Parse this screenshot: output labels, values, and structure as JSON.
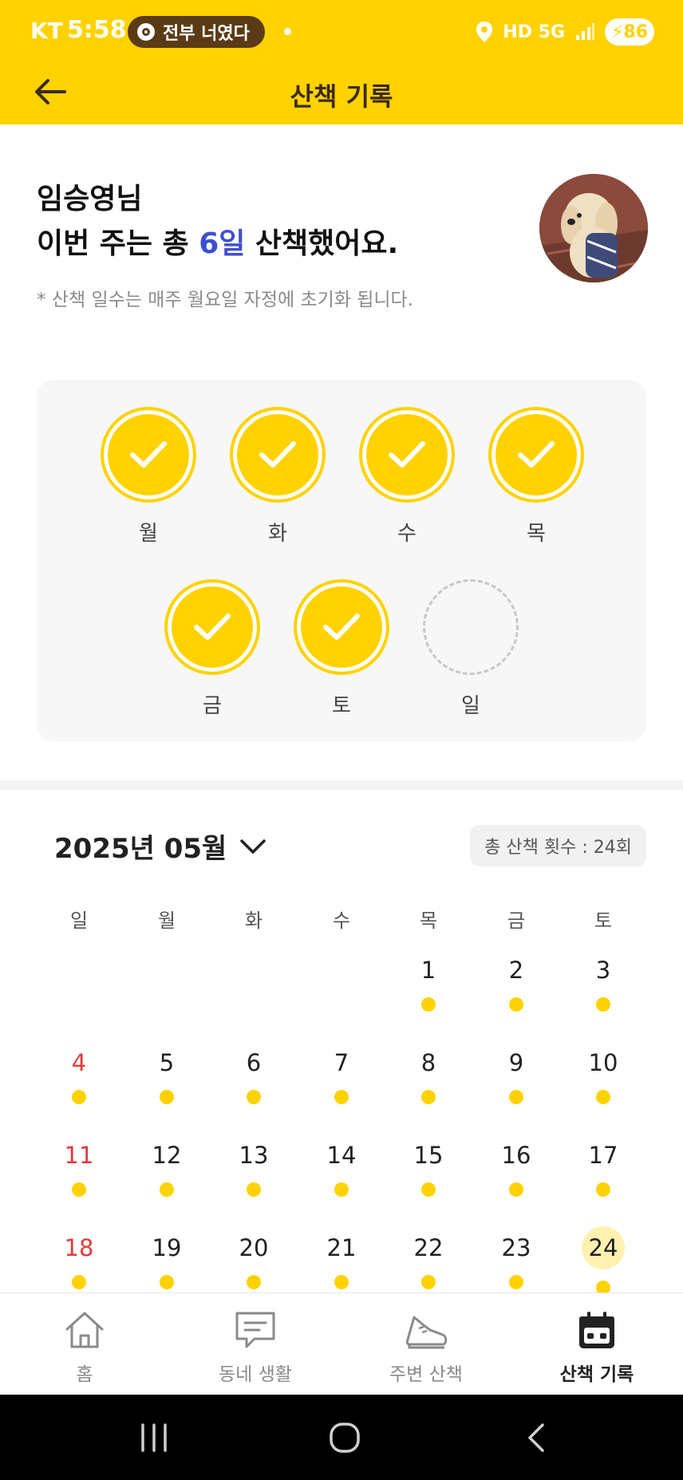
{
  "status_bar": {
    "carrier": "KT",
    "time": "5:58",
    "media_text": "전부 너였다",
    "network": "HD 5G",
    "battery": "86"
  },
  "header": {
    "title": "산책 기록"
  },
  "greeting": {
    "name_line": "임승영님",
    "summary_prefix": "이번 주는 총 ",
    "summary_highlight": "6일",
    "summary_suffix": " 산책했어요.",
    "note": "* 산책 일수는 매주 월요일 자정에 초기화 됩니다."
  },
  "week": [
    {
      "label": "월",
      "walked": true
    },
    {
      "label": "화",
      "walked": true
    },
    {
      "label": "수",
      "walked": true
    },
    {
      "label": "목",
      "walked": true
    },
    {
      "label": "금",
      "walked": true
    },
    {
      "label": "토",
      "walked": true
    },
    {
      "label": "일",
      "walked": false
    }
  ],
  "calendar": {
    "month_label": "2025년 05월",
    "total_count": "총 산책 횟수 : 24회",
    "weekdays": [
      "일",
      "월",
      "화",
      "수",
      "목",
      "금",
      "토"
    ],
    "rows": [
      [
        "",
        "",
        "",
        "",
        "1",
        "2",
        "3"
      ],
      [
        "4",
        "5",
        "6",
        "7",
        "8",
        "9",
        "10"
      ],
      [
        "11",
        "12",
        "13",
        "14",
        "15",
        "16",
        "17"
      ],
      [
        "18",
        "19",
        "20",
        "21",
        "22",
        "23",
        "24"
      ]
    ],
    "today": "24"
  },
  "nav": {
    "home": "홈",
    "community": "동네 생활",
    "nearby_walk": "주변 산책",
    "walk_record": "산책 기록"
  },
  "colors": {
    "accent": "#FFD200",
    "highlight": "#3d4fd1",
    "sunday": "#e03b3b"
  }
}
